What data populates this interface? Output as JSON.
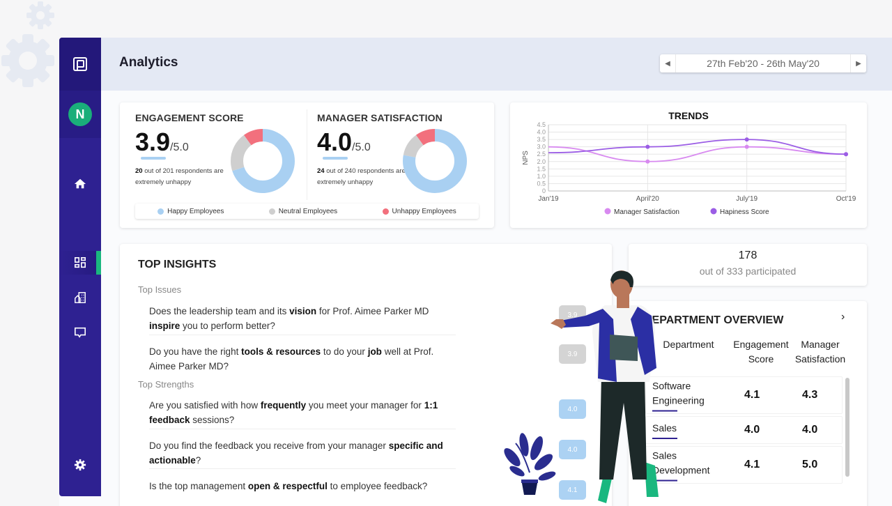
{
  "header": {
    "title": "Analytics",
    "date_range": "27th Feb'20 - 26th May'20"
  },
  "sidebar": {
    "user_initial": "N",
    "items": [
      {
        "name": "home",
        "icon": "home-icon",
        "active": false
      },
      {
        "name": "dashboard",
        "icon": "dashboard-icon",
        "active": true
      },
      {
        "name": "buildings",
        "icon": "building-icon",
        "active": false
      },
      {
        "name": "feedback",
        "icon": "message-icon",
        "active": false
      },
      {
        "name": "settings",
        "icon": "gear-icon",
        "active": false
      }
    ]
  },
  "scores": {
    "engagement": {
      "title": "ENGAGEMENT SCORE",
      "value": "3.9",
      "out_of": "/5.0",
      "unhappy_count": "20",
      "note": " out of 201 respondents are extremely unhappy",
      "distribution": {
        "happy": 0.7,
        "neutral": 0.2,
        "unhappy": 0.1
      }
    },
    "manager": {
      "title": "MANAGER SATISFACTION",
      "value": "4.0",
      "out_of": "/5.0",
      "unhappy_count": "24",
      "note": " out of 240 respondents are extremely unhappy",
      "distribution": {
        "happy": 0.78,
        "neutral": 0.12,
        "unhappy": 0.1
      }
    },
    "legend": [
      {
        "label": "Happy Employees",
        "color": "#a9d0f2"
      },
      {
        "label": "Neutral Employees",
        "color": "#cfcfcf"
      },
      {
        "label": "Unhappy Employees",
        "color": "#f2707d"
      }
    ]
  },
  "chart_data": {
    "type": "line",
    "title": "TRENDS",
    "xlabel": "",
    "ylabel": "NPS",
    "categories": [
      "Jan'19",
      "April'20",
      "July'19",
      "Oct'19"
    ],
    "ylim": [
      0,
      4.5
    ],
    "yticks": [
      "0",
      "0.5",
      "1.0",
      "1.5",
      "2.0",
      "2.5",
      "3.0",
      "3.5",
      "4.0",
      "4.5"
    ],
    "grid": true,
    "legend_position": "bottom",
    "series": [
      {
        "name": "Manager Satisfaction",
        "color": "#d88af0",
        "values": [
          3.0,
          2.0,
          3.0,
          2.5
        ]
      },
      {
        "name": "Hapiness Score",
        "color": "#9b5de5",
        "values": [
          2.6,
          3.0,
          3.5,
          2.5
        ]
      }
    ]
  },
  "insights": {
    "title": "TOP INSIGHTS",
    "issues_label": "Top Issues",
    "strengths_label": "Top Strengths",
    "issues": [
      {
        "parts": [
          [
            "Does the leadership team and its ",
            false
          ],
          [
            "vision",
            true
          ],
          [
            " for Prof. Aimee Parker MD ",
            false
          ],
          [
            "inspire",
            true
          ],
          [
            " you to perform better?",
            false
          ]
        ],
        "score": "3.9"
      },
      {
        "parts": [
          [
            "Do you have the right ",
            false
          ],
          [
            "tools & resources",
            true
          ],
          [
            " to do your ",
            false
          ],
          [
            "job",
            true
          ],
          [
            " well at Prof. Aimee Parker MD?",
            false
          ]
        ],
        "score": "3.9"
      }
    ],
    "strengths": [
      {
        "parts": [
          [
            "Are you satisfied with how ",
            false
          ],
          [
            "frequently",
            true
          ],
          [
            " you meet your manager for ",
            false
          ],
          [
            "1:1 feedback",
            true
          ],
          [
            " sessions?",
            false
          ]
        ],
        "score": "4.0"
      },
      {
        "parts": [
          [
            "Do you find the feedback you receive from your manager ",
            false
          ],
          [
            "specific and actionable",
            true
          ],
          [
            "?",
            false
          ]
        ],
        "score": "4.0"
      },
      {
        "parts": [
          [
            "Is the top management ",
            false
          ],
          [
            "open & respectful",
            true
          ],
          [
            " to employee feedback?",
            false
          ]
        ],
        "score": "4.1"
      }
    ]
  },
  "participation": {
    "count": "178",
    "label": "out of 333 participated"
  },
  "department": {
    "title": "DEPARTMENT OVERVIEW",
    "columns": {
      "department": "Department",
      "engagement": "Engagement Score",
      "manager": "Manager Satisfaction"
    },
    "rows": [
      {
        "name": "Software Engineering",
        "engagement": "4.1",
        "manager": "4.3"
      },
      {
        "name": "Sales",
        "engagement": "4.0",
        "manager": "4.0"
      },
      {
        "name": "Sales Development",
        "engagement": "4.1",
        "manager": "5.0"
      }
    ]
  }
}
